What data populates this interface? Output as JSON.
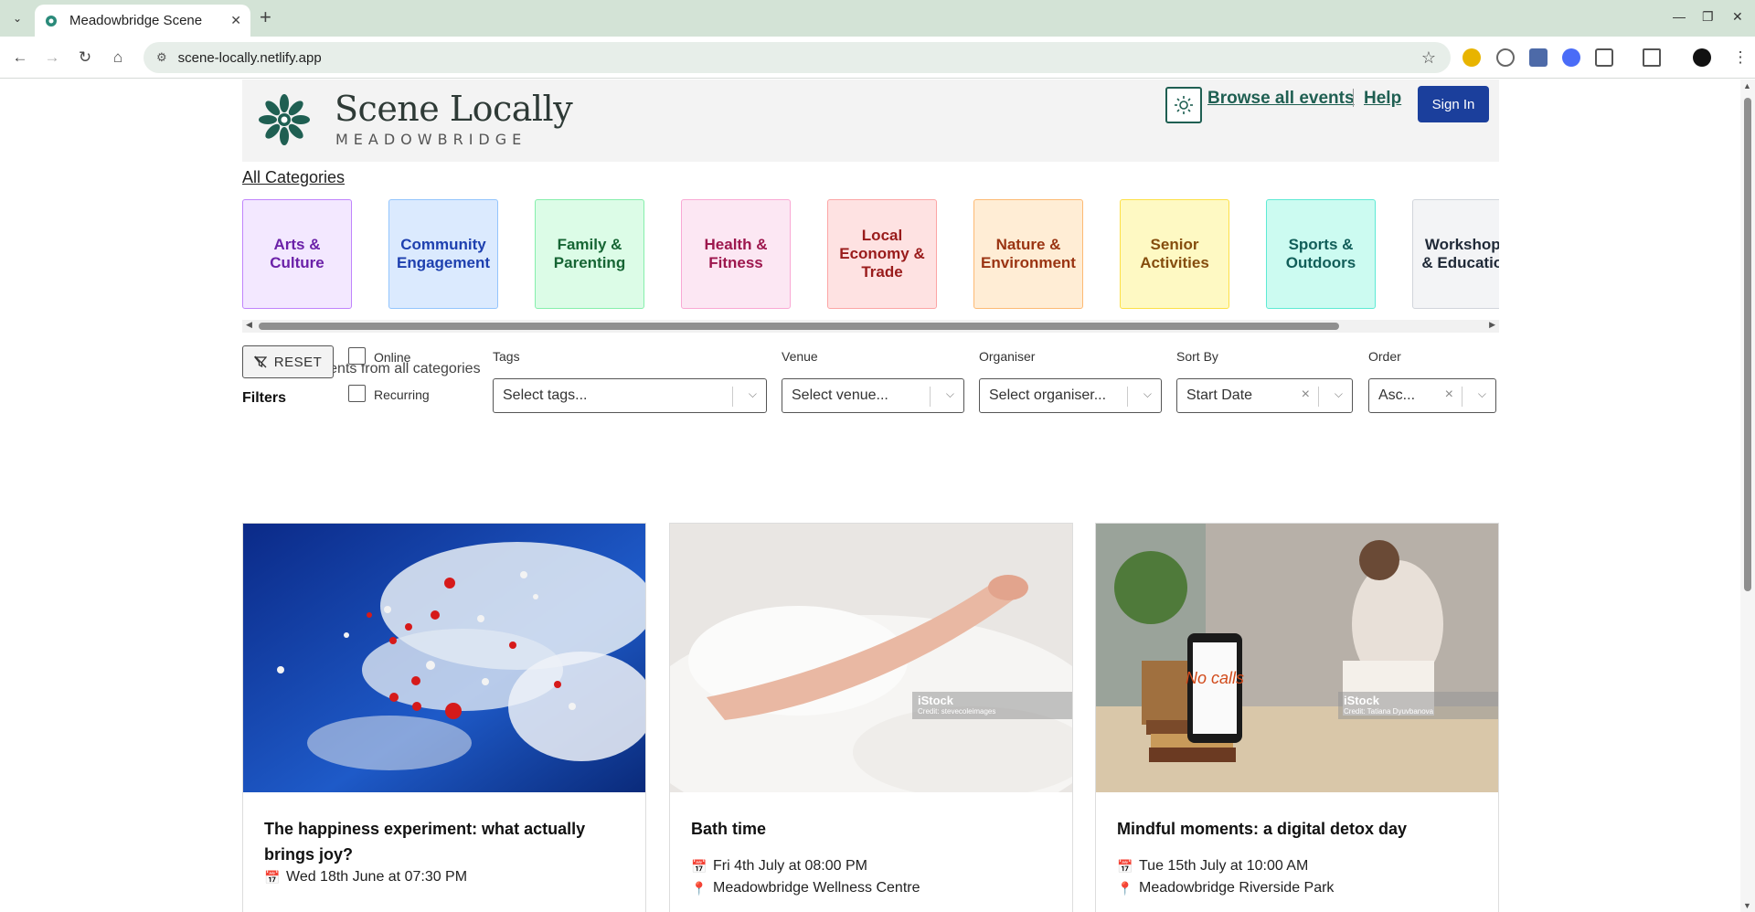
{
  "browser": {
    "tab_title": "Meadowbridge Scene",
    "url": "scene-locally.netlify.app"
  },
  "header": {
    "brand_title": "Scene Locally",
    "brand_sub": "MEADOWBRIDGE",
    "browse_link": "Browse all events",
    "help_link": "Help",
    "signin": "Sign In"
  },
  "categories": {
    "all_label": "All Categories",
    "items": [
      {
        "label": "Arts & Culture",
        "bg": "#f3e8ff",
        "border": "#c084fc",
        "color": "#6b21a8"
      },
      {
        "label": "Community Engagement",
        "bg": "#dbeafe",
        "border": "#93c5fd",
        "color": "#1e40af"
      },
      {
        "label": "Family & Parenting",
        "bg": "#dcfce7",
        "border": "#86efac",
        "color": "#166534"
      },
      {
        "label": "Health & Fitness",
        "bg": "#fce7f3",
        "border": "#f9a8d4",
        "color": "#9d174d"
      },
      {
        "label": "Local Economy & Trade",
        "bg": "#fee2e2",
        "border": "#fca5a5",
        "color": "#991b1b"
      },
      {
        "label": "Nature & Environment",
        "bg": "#ffedd5",
        "border": "#fdba74",
        "color": "#9a3412"
      },
      {
        "label": "Senior Activities",
        "bg": "#fef9c3",
        "border": "#fde047",
        "color": "#854d0e"
      },
      {
        "label": "Sports & Outdoors",
        "bg": "#ccfbf1",
        "border": "#5eead4",
        "color": "#115e59"
      },
      {
        "label": "Workshops & Education",
        "bg": "#f3f4f6",
        "border": "#d1d5db",
        "color": "#1f2937"
      }
    ]
  },
  "filters": {
    "displaying": "Displaying events from all categories",
    "heading": "Filters",
    "reset": "RESET",
    "online": "Online",
    "recurring": "Recurring",
    "tags_label": "Tags",
    "tags_placeholder": "Select tags...",
    "venue_label": "Venue",
    "venue_placeholder": "Select venue...",
    "organiser_label": "Organiser",
    "organiser_placeholder": "Select organiser...",
    "sortby_label": "Sort By",
    "sortby_value": "Start Date",
    "order_label": "Order",
    "order_value": "Asc..."
  },
  "events": [
    {
      "title": "The happiness experiment: what actually brings joy?",
      "date": "Wed 18th June at 07:30 PM",
      "venue": ""
    },
    {
      "title": "Bath time",
      "date": "Fri 4th July at 08:00 PM",
      "venue": "Meadowbridge Wellness Centre",
      "credit": "Credit: stevecoleimages"
    },
    {
      "title": "Mindful moments: a digital detox day",
      "date": "Tue 15th July at 10:00 AM",
      "venue": "Meadowbridge Riverside Park",
      "credit": "Credit: Tatiana Dyuvbanova"
    }
  ],
  "watermark": "iStock",
  "phone_text": "No calls"
}
